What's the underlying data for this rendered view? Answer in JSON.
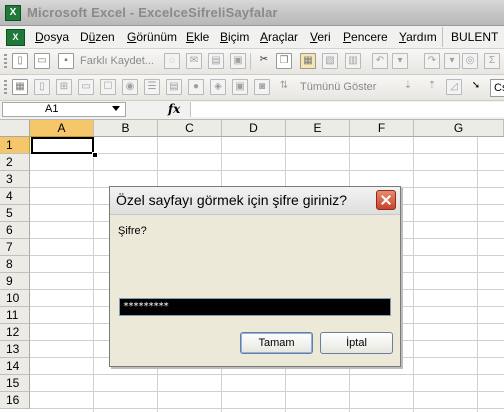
{
  "window": {
    "title": "Microsoft Excel - ExcelceSifreliSayfalar",
    "app_icon_glyph": "X"
  },
  "menubar": {
    "items": [
      {
        "pre": "",
        "u": "D",
        "post": "osya"
      },
      {
        "pre": "D",
        "u": "ü",
        "post": "zen"
      },
      {
        "pre": "",
        "u": "G",
        "post": "örünüm"
      },
      {
        "pre": "",
        "u": "E",
        "post": "kle"
      },
      {
        "pre": "",
        "u": "B",
        "post": "içim"
      },
      {
        "pre": "",
        "u": "A",
        "post": "raçlar"
      },
      {
        "pre": "",
        "u": "V",
        "post": "eri"
      },
      {
        "pre": "",
        "u": "P",
        "post": "encere"
      },
      {
        "pre": "",
        "u": "Y",
        "post": "ardım"
      }
    ],
    "user": "BULENT"
  },
  "toolbar1": {
    "save_as_label": "Farklı Kaydet..."
  },
  "toolbar2": {
    "show_all_label": "Tümünü Göster",
    "cond_box_text": "Cs"
  },
  "formula_bar": {
    "name_box": "A1",
    "fx_label": "fx",
    "formula": ""
  },
  "sheet": {
    "columns": [
      "A",
      "B",
      "C",
      "D",
      "E",
      "F",
      "G"
    ],
    "rows": [
      "1",
      "2",
      "3",
      "4",
      "5",
      "6",
      "7",
      "8",
      "9",
      "10",
      "11",
      "12",
      "13",
      "14",
      "15",
      "16"
    ],
    "active_cell": "A1"
  },
  "dialog": {
    "title": "Özel sayfayı görmek için şifre giriniz?",
    "prompt": "Şifre?",
    "input_value": "*********",
    "ok_label": "Tamam",
    "cancel_label": "İptal"
  }
}
